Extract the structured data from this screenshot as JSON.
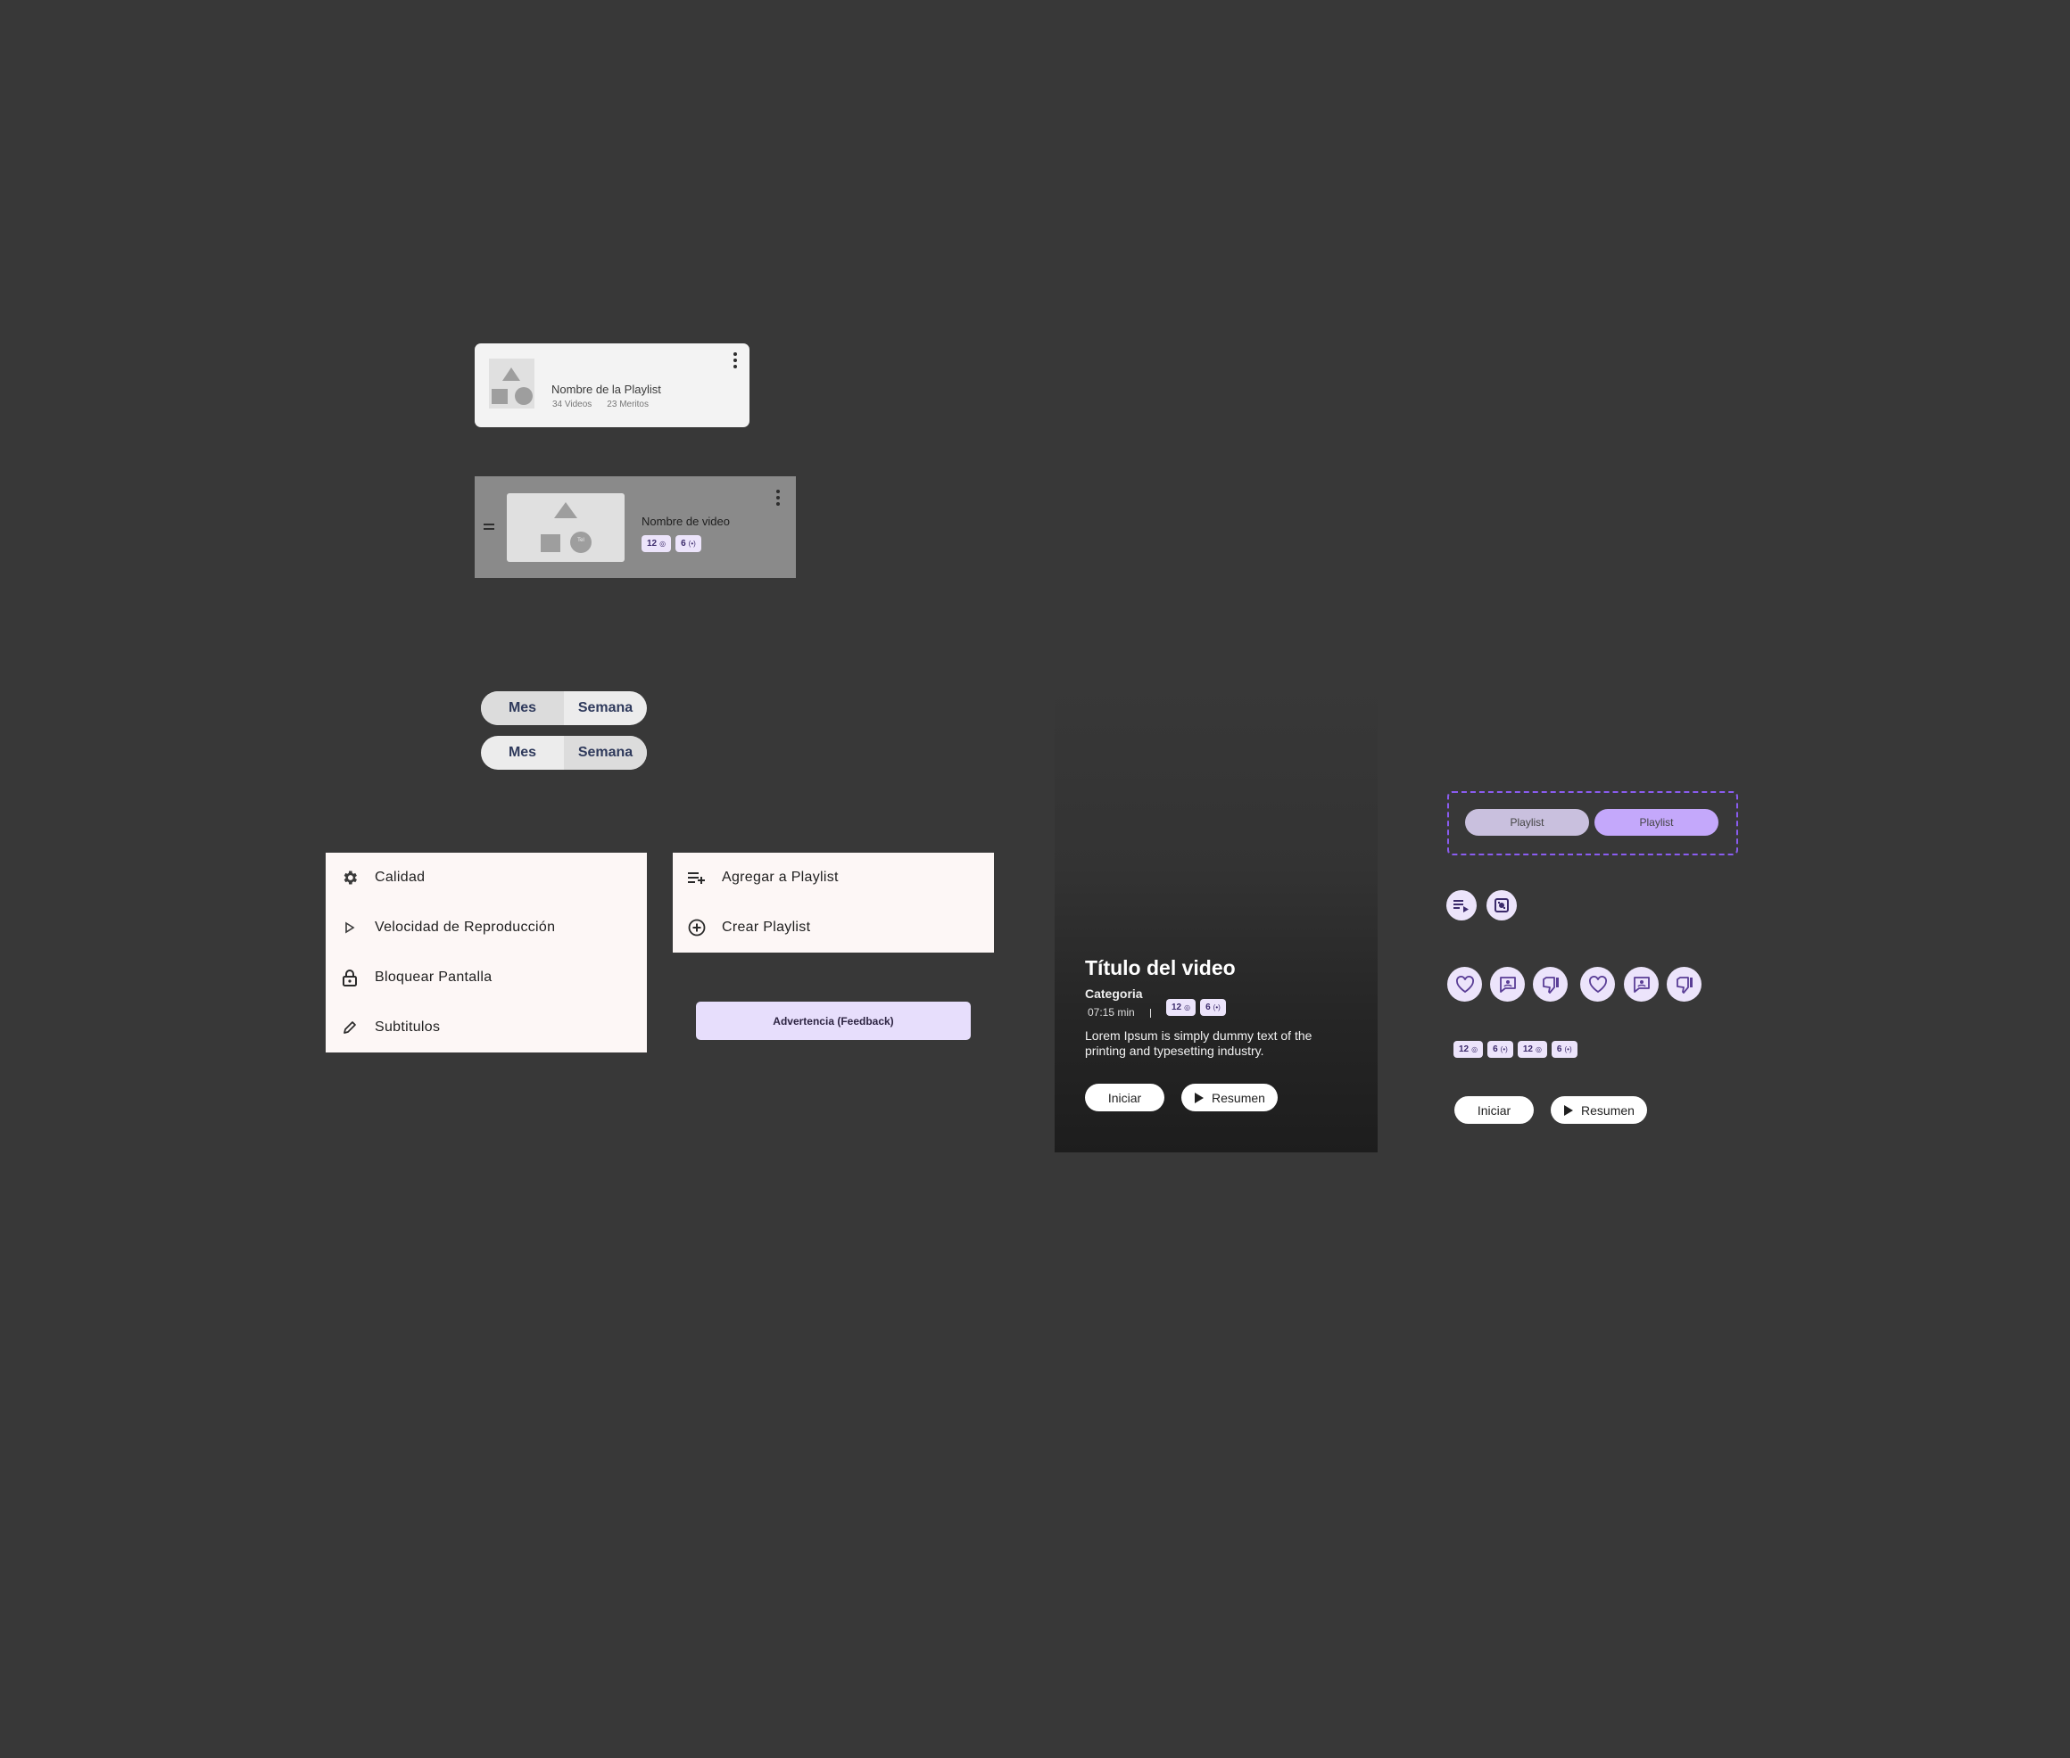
{
  "playlist_card": {
    "title": "Nombre de la Playlist",
    "videos": "34 Videos",
    "merits": "23 Meritos"
  },
  "video_row": {
    "title": "Nombre de video",
    "thumb_badge": "Tel",
    "chip_a": "12",
    "chip_b": "6"
  },
  "toggle_1": {
    "left": "Mes",
    "right": "Semana",
    "selected": "Mes"
  },
  "toggle_2": {
    "left": "Mes",
    "right": "Semana",
    "selected": "Semana"
  },
  "options_menu": {
    "items": [
      {
        "label": "Calidad",
        "icon": "gear-icon"
      },
      {
        "label": "Velocidad de Reproducción",
        "icon": "play-outline-icon"
      },
      {
        "label": "Bloquear Pantalla",
        "icon": "lock-icon"
      },
      {
        "label": "Subtitulos",
        "icon": "pencil-icon"
      }
    ]
  },
  "playlist_menu": {
    "items": [
      {
        "label": "Agregar a Playlist",
        "icon": "playlist-add-icon"
      },
      {
        "label": "Crear Playlist",
        "icon": "add-circle-icon"
      }
    ]
  },
  "feedback_button": {
    "label": "Advertencia (Feedback)"
  },
  "hero": {
    "title": "Título del video",
    "category": "Categoria",
    "duration": "07:15 min",
    "chip_a": "12",
    "chip_b": "6",
    "description": "Lorem Ipsum is simply dummy text of the printing and typesetting industry.",
    "start_label": "Iniciar",
    "summary_label": "Resumen"
  },
  "playlist_pills": {
    "a": "Playlist",
    "b": "Playlist"
  },
  "standalone_chips": {
    "a": "12",
    "b": "6",
    "c": "12",
    "d": "6"
  },
  "standalone_buttons": {
    "start_label": "Iniciar",
    "summary_label": "Resumen"
  },
  "colors": {
    "background": "#383838",
    "accent_light": "#ece4fb",
    "accent": "#c4a8fb",
    "accent_dark": "#5a3e96"
  }
}
